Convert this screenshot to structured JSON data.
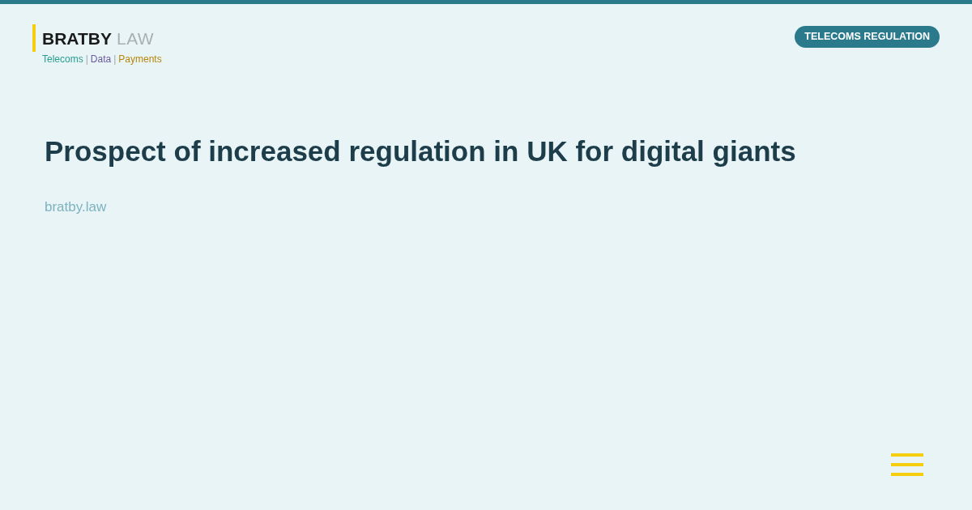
{
  "logo": {
    "name": "BRATBY",
    "suffix": "LAW"
  },
  "tagline": {
    "topics": [
      {
        "label": "Telecoms",
        "color": "#2a9d8f"
      },
      {
        "label": "Data",
        "color": "#6a5a9e"
      },
      {
        "label": "Payments",
        "color": "#b8860b"
      }
    ],
    "separators": [
      "|",
      "|"
    ]
  },
  "category_badge": "TELECOMS REGULATION",
  "title": "Prospect of increased regulation in UK for digital giants",
  "site_url": "bratby.law"
}
